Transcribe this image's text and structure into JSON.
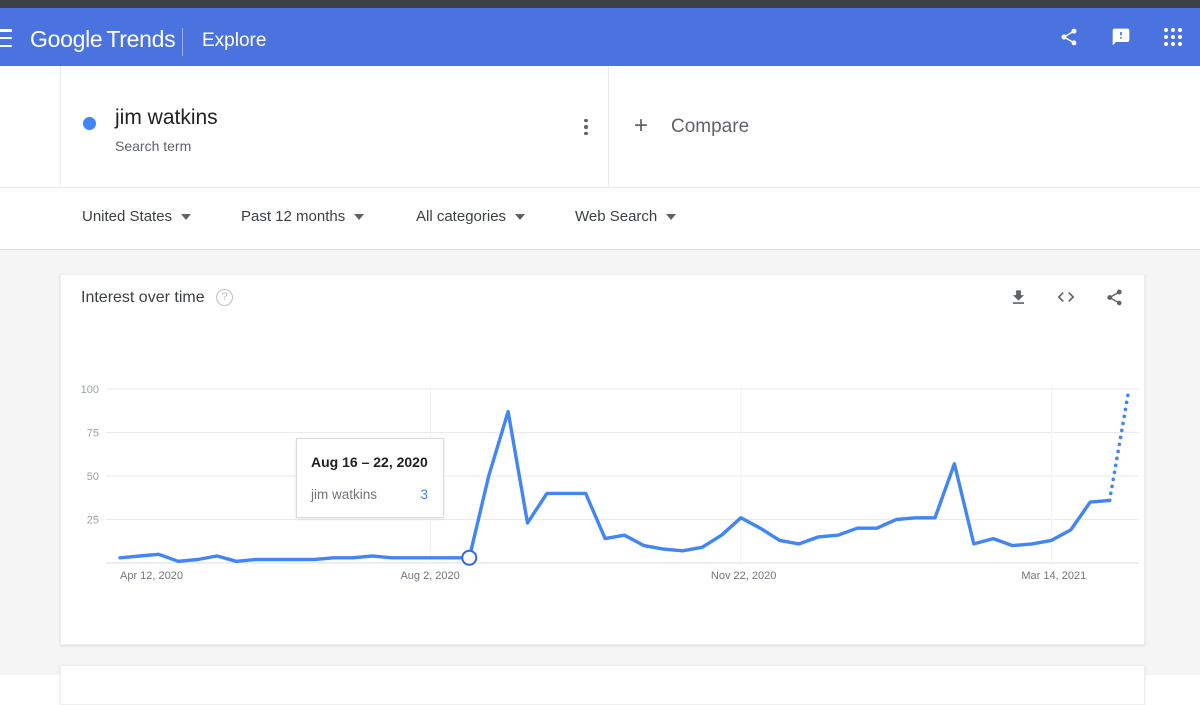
{
  "appbar": {
    "menu_icon": "hamburger-menu-icon",
    "brand_google": "Google",
    "brand_trends": "Trends",
    "explore_label": "Explore",
    "share_icon": "share-icon",
    "feedback_icon": "feedback-icon",
    "apps_icon": "apps-grid-icon",
    "background_color": "#4a73df"
  },
  "search_term": {
    "term": "jim watkins",
    "type_label": "Search term",
    "dot_color": "#4285f4",
    "menu_icon": "more-options-icon"
  },
  "compare": {
    "plus": "+",
    "label": "Compare"
  },
  "filters": [
    {
      "label": "United States",
      "name": "location-filter"
    },
    {
      "label": "Past 12 months",
      "name": "time-range-filter"
    },
    {
      "label": "All categories",
      "name": "category-filter"
    },
    {
      "label": "Web Search",
      "name": "search-type-filter"
    }
  ],
  "card": {
    "title": "Interest over time",
    "help_icon": "help-circle-icon",
    "help_glyph": "?",
    "download_icon": "download-icon",
    "embed_icon": "embed-code-icon",
    "share_icon": "share-icon"
  },
  "tooltip": {
    "date": "Aug 16 – 22, 2020",
    "series": "jim watkins",
    "value": "3"
  },
  "chart_data": {
    "type": "line",
    "title": "Interest over time",
    "xlabel": "",
    "ylabel": "",
    "ylim": [
      0,
      100
    ],
    "yticks": [
      25,
      50,
      75,
      100
    ],
    "grid": true,
    "legend": false,
    "line_color": "#4285f4",
    "xtick_labels": [
      "Apr 12, 2020",
      "Aug 2, 2020",
      "Nov 22, 2020",
      "Mar 14, 2021"
    ],
    "xtick_indices": [
      0,
      16,
      32,
      48
    ],
    "x": [
      "Apr 12, 2020",
      "Apr 19, 2020",
      "Apr 26, 2020",
      "May 3, 2020",
      "May 10, 2020",
      "May 17, 2020",
      "May 24, 2020",
      "May 31, 2020",
      "Jun 7, 2020",
      "Jun 14, 2020",
      "Jun 21, 2020",
      "Jun 28, 2020",
      "Jul 5, 2020",
      "Jul 12, 2020",
      "Jul 19, 2020",
      "Jul 26, 2020",
      "Aug 2, 2020",
      "Aug 9, 2020",
      "Aug 16, 2020",
      "Aug 23, 2020",
      "Aug 30, 2020",
      "Sep 6, 2020",
      "Sep 13, 2020",
      "Sep 20, 2020",
      "Sep 27, 2020",
      "Oct 4, 2020",
      "Oct 11, 2020",
      "Oct 18, 2020",
      "Oct 25, 2020",
      "Nov 1, 2020",
      "Nov 8, 2020",
      "Nov 15, 2020",
      "Nov 22, 2020",
      "Nov 29, 2020",
      "Dec 6, 2020",
      "Dec 13, 2020",
      "Dec 20, 2020",
      "Dec 27, 2020",
      "Jan 3, 2021",
      "Jan 10, 2021",
      "Jan 17, 2021",
      "Jan 24, 2021",
      "Jan 31, 2021",
      "Feb 7, 2021",
      "Feb 14, 2021",
      "Feb 21, 2021",
      "Feb 28, 2021",
      "Mar 7, 2021",
      "Mar 14, 2021",
      "Mar 21, 2021",
      "Mar 28, 2021",
      "Apr 4, 2021"
    ],
    "values": [
      3,
      4,
      5,
      1,
      2,
      4,
      1,
      2,
      2,
      2,
      2,
      3,
      3,
      4,
      3,
      3,
      3,
      3,
      3,
      50,
      87,
      23,
      40,
      40,
      40,
      14,
      16,
      10,
      8,
      7,
      9,
      16,
      26,
      20,
      13,
      11,
      15,
      16,
      20,
      20,
      25,
      26,
      26,
      57,
      11,
      14,
      10,
      11,
      13,
      19,
      35,
      36
    ],
    "partial_from_index": 51,
    "partial_value": 100,
    "highlighted_point": {
      "index": 18,
      "label": "Aug 16 – 22, 2020",
      "value": 3
    },
    "annotations": [
      "final segment dotted — incomplete data"
    ]
  }
}
